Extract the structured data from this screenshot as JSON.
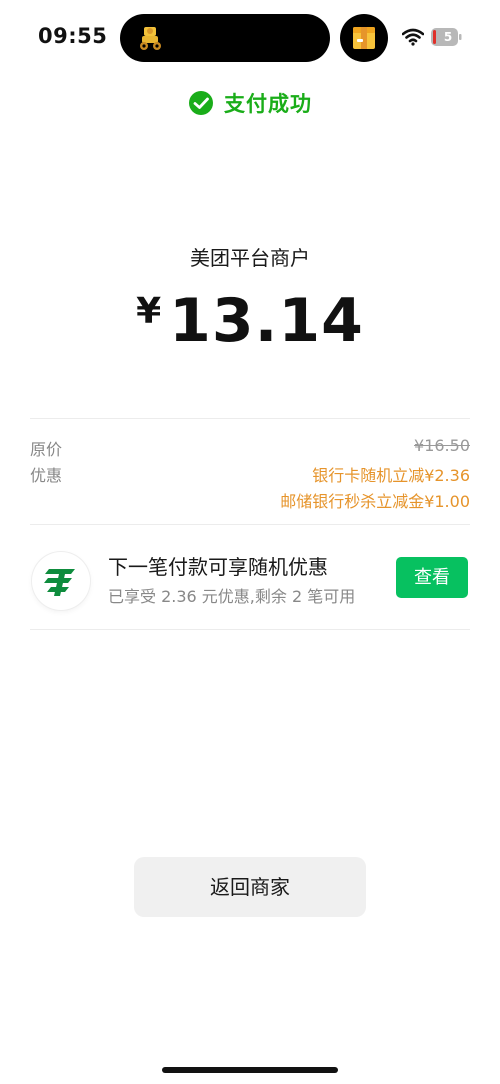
{
  "status_bar": {
    "time": "09:55",
    "battery_level": "5"
  },
  "header": {
    "status_text": "支付成功",
    "accent_color": "#1aad19"
  },
  "payment": {
    "merchant": "美团平台商户",
    "currency_symbol": "¥",
    "amount": "13.14"
  },
  "details": {
    "original_price_label": "原价",
    "original_price_value": "¥16.50",
    "discount_label": "优惠",
    "discounts": [
      "银行卡随机立减¥2.36",
      "邮储银行秒杀立减金¥1.00"
    ],
    "discount_color": "#e6942b"
  },
  "promo": {
    "title": "下一笔付款可享随机优惠",
    "subtitle": "已享受 2.36 元优惠,剩余 2 笔可用",
    "button_label": "查看",
    "button_color": "#07c160",
    "logo_icon": "postal-savings-bank-logo-icon"
  },
  "footer": {
    "back_button_label": "返回商家"
  }
}
